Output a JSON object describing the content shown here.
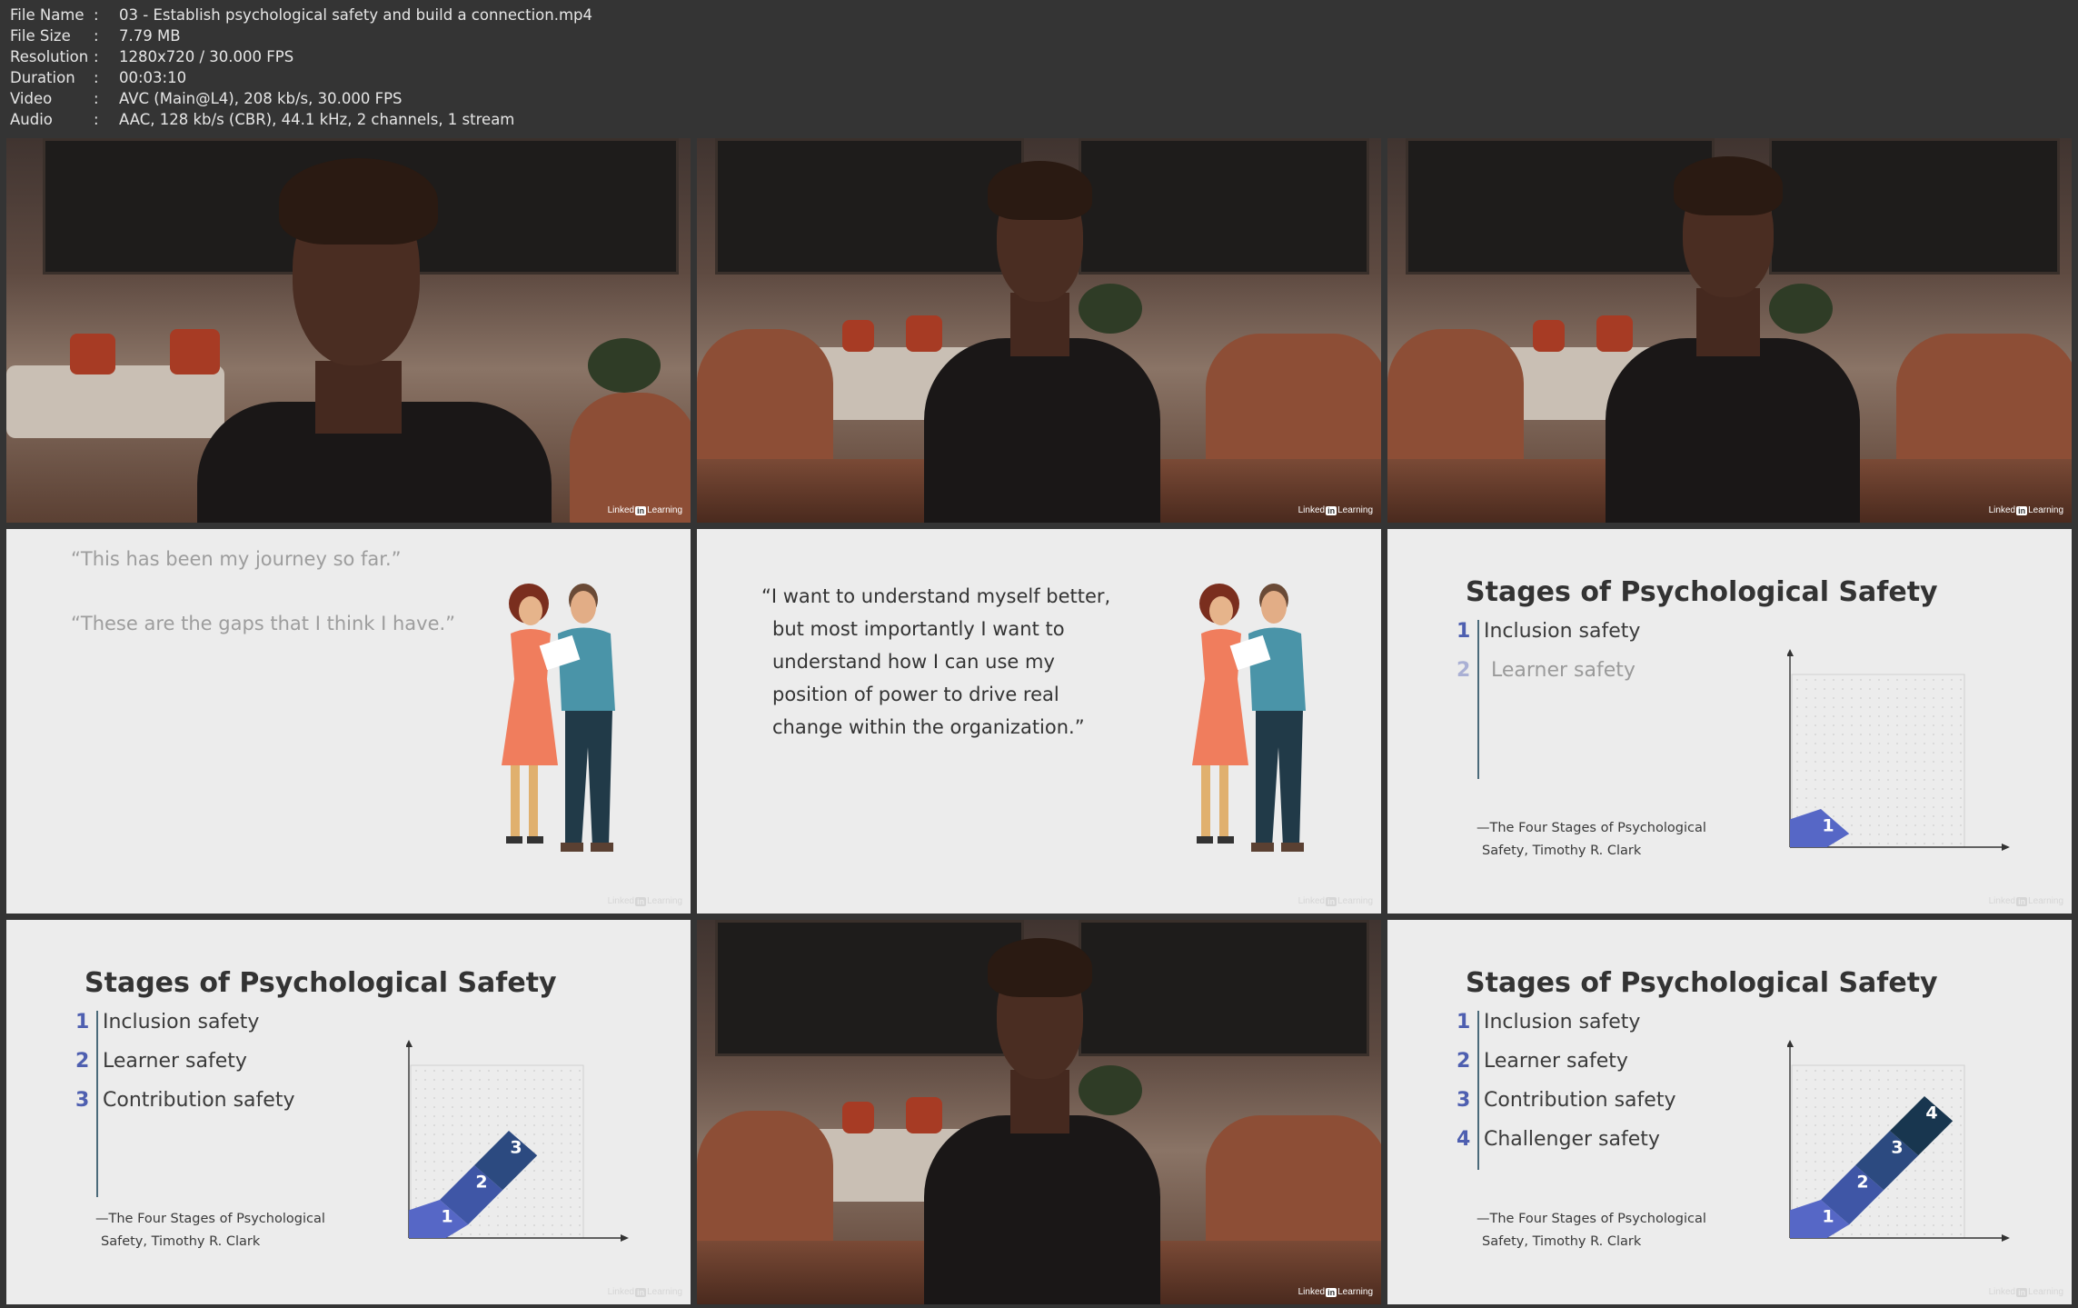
{
  "meta": {
    "rows": [
      {
        "key": "File Name",
        "value": "03 - Establish psychological safety and build a connection.mp4"
      },
      {
        "key": "File Size",
        "value": "7.79 MB"
      },
      {
        "key": "Resolution",
        "value": "1280x720 / 30.000 FPS"
      },
      {
        "key": "Duration",
        "value": "00:03:10"
      },
      {
        "key": "Video",
        "value": "AVC (Main@L4), 208 kb/s, 30.000 FPS"
      },
      {
        "key": "Audio",
        "value": "AAC, 128 kb/s (CBR), 44.1 kHz, 2 channels, 1 stream"
      }
    ]
  },
  "logo": {
    "pre": "Linked",
    "in": "in",
    "post": "Learning"
  },
  "quotes1": {
    "line1": "“This has been my journey so far.”",
    "line2": "“These are the gaps that I think I have.”"
  },
  "quote2": {
    "l1": "“I want to understand myself better,",
    "l2": "but most importantly I want to",
    "l3": "understand how I can use my",
    "l4": "position of power to drive real",
    "l5": "change within the organization.”"
  },
  "stages": {
    "title": "Stages of Psychological Safety",
    "items": [
      {
        "num": "1",
        "label": "Inclusion safety"
      },
      {
        "num": "2",
        "label": "Learner safety"
      },
      {
        "num": "3",
        "label": "Contribution safety"
      },
      {
        "num": "4",
        "label": "Challenger safety"
      }
    ],
    "cite1": "—The Four Stages of Psychological",
    "cite2": "Safety, Timothy R. Clark",
    "step_colors": [
      "#5667c6",
      "#3f56a6",
      "#2c4a80",
      "#18364f"
    ]
  }
}
